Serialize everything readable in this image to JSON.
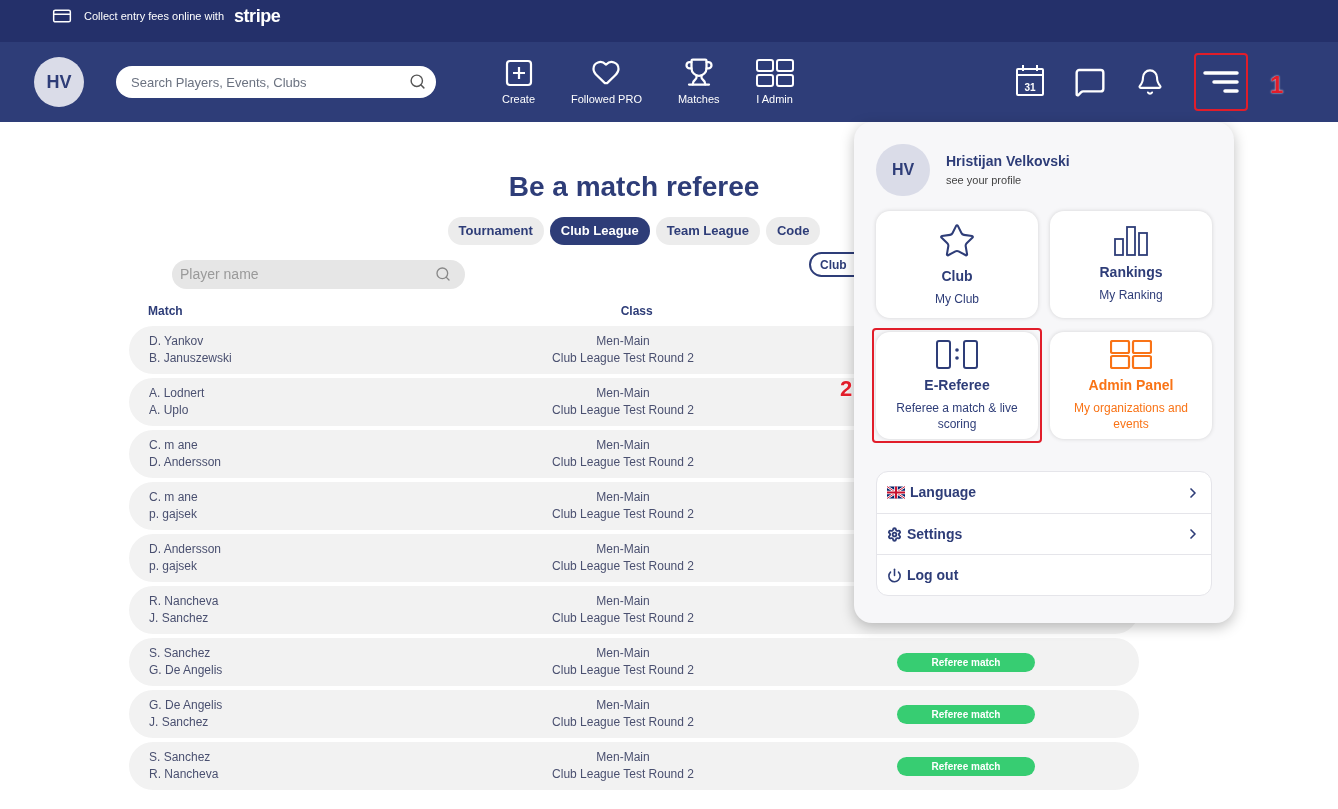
{
  "promo": {
    "text": "Collect entry fees online with",
    "brand": "stripe"
  },
  "nav": {
    "avatar": "HV",
    "search_placeholder": "Search Players, Events, Clubs",
    "items": [
      {
        "kind": "create",
        "label": "Create"
      },
      {
        "kind": "heart",
        "label": "Followed PRO"
      },
      {
        "kind": "trophy",
        "label": "Matches"
      },
      {
        "kind": "grid",
        "label": "I Admin"
      }
    ],
    "icons": [
      {
        "kind": "calendar",
        "text": "31"
      },
      {
        "kind": "chat"
      },
      {
        "kind": "bell"
      },
      {
        "kind": "menu",
        "annotation": "1"
      }
    ]
  },
  "page": {
    "title": "Be a match referee",
    "tabs": [
      {
        "label": "Tournament",
        "selected": false
      },
      {
        "label": "Club League",
        "selected": true
      },
      {
        "label": "Team League",
        "selected": false
      },
      {
        "label": "Code",
        "selected": false
      }
    ],
    "player_search_placeholder": "Player name",
    "filter": "Club",
    "columns": [
      "Match",
      "Class"
    ],
    "rows": [
      {
        "players": [
          "D. Yankov",
          "B. Januszewski"
        ],
        "class": [
          "Men-Main",
          "Club League Test Round 2"
        ]
      },
      {
        "players": [
          "A. Lodnert",
          "A. Uplo"
        ],
        "class": [
          "Men-Main",
          "Club League Test Round 2"
        ]
      },
      {
        "players": [
          "C. m ane",
          "D. Andersson"
        ],
        "class": [
          "Men-Main",
          "Club League Test Round 2"
        ]
      },
      {
        "players": [
          "C. m ane",
          "p. gajsek"
        ],
        "class": [
          "Men-Main",
          "Club League Test Round 2"
        ]
      },
      {
        "players": [
          "D. Andersson",
          "p. gajsek"
        ],
        "class": [
          "Men-Main",
          "Club League Test Round 2"
        ]
      },
      {
        "players": [
          "R. Nancheva",
          "J. Sanchez"
        ],
        "class": [
          "Men-Main",
          "Club League Test Round 2"
        ]
      },
      {
        "players": [
          "S. Sanchez",
          "G. De Angelis"
        ],
        "class": [
          "Men-Main",
          "Club League Test Round 2"
        ],
        "button": "Referee match"
      },
      {
        "players": [
          "G. De Angelis",
          "J. Sanchez"
        ],
        "class": [
          "Men-Main",
          "Club League Test Round 2"
        ],
        "button": "Referee match"
      },
      {
        "players": [
          "S. Sanchez",
          "R. Nancheva"
        ],
        "class": [
          "Men-Main",
          "Club League Test Round 2"
        ],
        "button": "Referee match"
      }
    ]
  },
  "menu": {
    "avatar": "HV",
    "name": "Hristijan Velkovski",
    "subtitle": "see your profile",
    "tiles": [
      {
        "kind": "club",
        "title": "Club",
        "subtitle": "My Club"
      },
      {
        "kind": "rankings",
        "title": "Rankings",
        "subtitle": "My Ranking"
      },
      {
        "kind": "referee",
        "title": "E-Referee",
        "subtitle": "Referee a match & live scoring",
        "annotation": "2"
      },
      {
        "kind": "admin",
        "title": "Admin Panel",
        "subtitle": "My organizations and events"
      }
    ],
    "links": [
      {
        "kind": "language",
        "label": "Language",
        "chevron": true
      },
      {
        "kind": "settings",
        "label": "Settings",
        "chevron": true
      },
      {
        "kind": "logout",
        "label": "Log out",
        "chevron": false
      }
    ]
  }
}
